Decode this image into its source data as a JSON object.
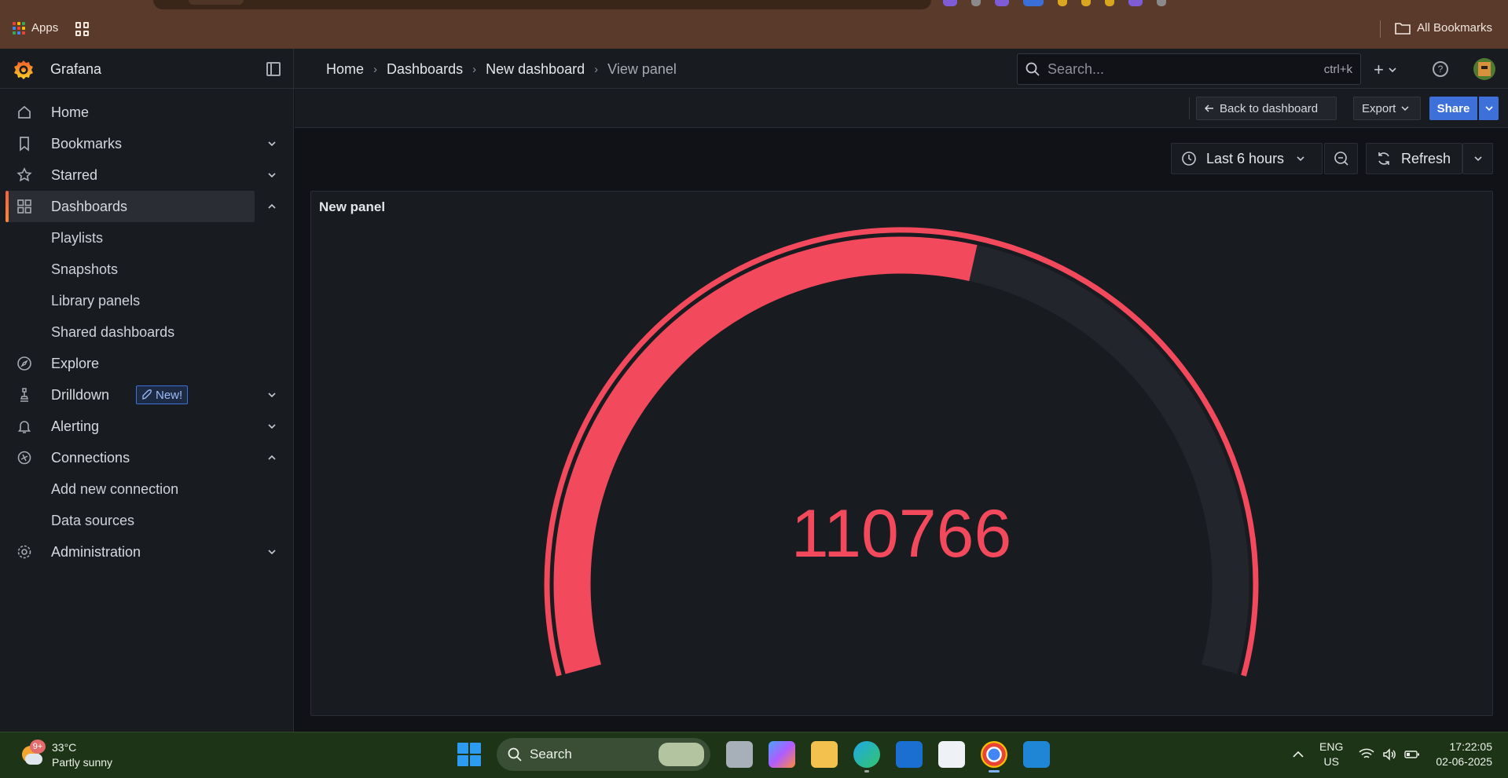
{
  "browser": {
    "apps_label": "Apps",
    "all_bookmarks_label": "All Bookmarks"
  },
  "grafana": {
    "brand": "Grafana",
    "breadcrumbs": [
      "Home",
      "Dashboards",
      "New dashboard",
      "View panel"
    ],
    "search": {
      "placeholder": "Search...",
      "shortcut": "ctrl+k"
    },
    "accent_color": "#f55f3e"
  },
  "sidebar": {
    "items": [
      {
        "label": "Home",
        "icon": "home-icon"
      },
      {
        "label": "Bookmarks",
        "icon": "bookmark-icon",
        "expand": "down"
      },
      {
        "label": "Starred",
        "icon": "star-icon",
        "expand": "down"
      },
      {
        "label": "Dashboards",
        "icon": "apps-icon",
        "expand": "up",
        "active": true
      },
      {
        "label": "Playlists",
        "sub": true
      },
      {
        "label": "Snapshots",
        "sub": true
      },
      {
        "label": "Library panels",
        "sub": true
      },
      {
        "label": "Shared dashboards",
        "sub": true
      },
      {
        "label": "Explore",
        "icon": "compass-icon"
      },
      {
        "label": "Drilldown",
        "icon": "drilldown-icon",
        "expand": "down",
        "badge": "New!"
      },
      {
        "label": "Alerting",
        "icon": "bell-icon",
        "expand": "down"
      },
      {
        "label": "Connections",
        "icon": "connections-icon",
        "expand": "up"
      },
      {
        "label": "Add new connection",
        "sub": true
      },
      {
        "label": "Data sources",
        "sub": true
      },
      {
        "label": "Administration",
        "icon": "cog-icon",
        "expand": "down"
      }
    ]
  },
  "panel_actions": {
    "back_label": "Back to dashboard",
    "export_label": "Export",
    "share_label": "Share"
  },
  "time_controls": {
    "range_label": "Last 6 hours",
    "refresh_label": "Refresh"
  },
  "panel": {
    "title": "New panel",
    "gauge_value": "110766",
    "gauge_fill_fraction": 0.56,
    "gauge_color": "#f2495c",
    "gauge_track_color": "#22252b"
  },
  "taskbar": {
    "weather": {
      "temp": "33°C",
      "condition": "Partly sunny",
      "badge": "9+"
    },
    "search_label": "Search",
    "lang_line1": "ENG",
    "lang_line2": "US",
    "time": "17:22:05",
    "date": "02-06-2025"
  }
}
